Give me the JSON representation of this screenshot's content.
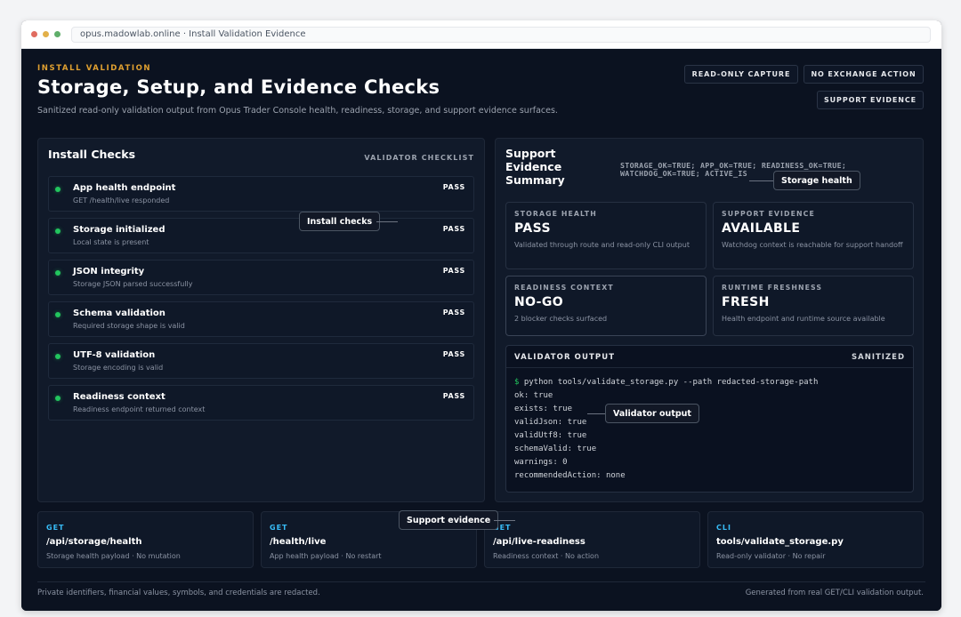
{
  "browser": {
    "url": "opus.madowlab.online · Install Validation Evidence",
    "dot_colors": [
      "#e06c60",
      "#e2b04a",
      "#5fae6a"
    ]
  },
  "header": {
    "eyebrow": "INSTALL VALIDATION",
    "title": "Storage, Setup, and Evidence Checks",
    "subtitle": "Sanitized read-only validation output from Opus Trader Console health, readiness, storage, and support evidence surfaces.",
    "tags": [
      "READ-ONLY CAPTURE",
      "NO EXCHANGE ACTION",
      "SUPPORT EVIDENCE"
    ]
  },
  "install_checks": {
    "title": "Install Checks",
    "kicker": "VALIDATOR CHECKLIST",
    "items": [
      {
        "name": "App health endpoint",
        "desc": "GET /health/live responded",
        "status": "PASS"
      },
      {
        "name": "Storage initialized",
        "desc": "Local state is present",
        "status": "PASS"
      },
      {
        "name": "JSON integrity",
        "desc": "Storage JSON parsed successfully",
        "status": "PASS"
      },
      {
        "name": "Schema validation",
        "desc": "Required storage shape is valid",
        "status": "PASS"
      },
      {
        "name": "UTF-8 validation",
        "desc": "Storage encoding is valid",
        "status": "PASS"
      },
      {
        "name": "Readiness context",
        "desc": "Readiness endpoint returned context",
        "status": "PASS"
      }
    ]
  },
  "support_summary": {
    "title_lines": [
      "Support",
      "Evidence",
      "Summary"
    ],
    "flags_lines": [
      "STORAGE_OK=TRUE; APP_OK=TRUE; READINESS_OK=TRUE;",
      "WATCHDOG_OK=TRUE; ACTIVE_IS"
    ],
    "cards": [
      {
        "label": "STORAGE HEALTH",
        "value": "PASS",
        "desc": "Validated through route and read-only CLI output"
      },
      {
        "label": "SUPPORT EVIDENCE",
        "value": "AVAILABLE",
        "desc": "Watchdog context is reachable for support handoff"
      },
      {
        "label": "READINESS CONTEXT",
        "value": "NO-GO",
        "desc": "2 blocker checks surfaced"
      },
      {
        "label": "RUNTIME FRESHNESS",
        "value": "FRESH",
        "desc": "Health endpoint and runtime source available"
      }
    ],
    "validator": {
      "title": "VALIDATOR OUTPUT",
      "tag": "SANITIZED",
      "prompt": "$",
      "command": "python tools/validate_storage.py --path redacted-storage-path",
      "lines": [
        "ok: true",
        "exists: true",
        "validJson: true",
        "validUtf8: true",
        "schemaValid: true",
        "warnings: 0",
        "recommendedAction: none"
      ]
    }
  },
  "routes": [
    {
      "method": "GET",
      "path": "/api/storage/health",
      "desc": "Storage health payload · No mutation"
    },
    {
      "method": "GET",
      "path": "/health/live",
      "desc": "App health payload · No restart"
    },
    {
      "method": "GET",
      "path": "/api/live-readiness",
      "desc": "Readiness context · No action"
    },
    {
      "method": "CLI",
      "path": "tools/validate_storage.py",
      "desc": "Read-only validator · No repair"
    }
  ],
  "footer": {
    "left": "Private identifiers, financial values, symbols, and credentials are redacted.",
    "right": "Generated from real GET/CLI validation output."
  },
  "callouts": {
    "install_checks": "Install checks",
    "storage_health": "Storage health",
    "validator_output": "Validator output",
    "support_evidence": "Support evidence"
  },
  "colors": {
    "background": "#0b1220",
    "panel": "#111a2a",
    "accent_eyebrow": "#e0a030",
    "status_ok": "#22c55e",
    "method_label": "#38bdf8"
  }
}
